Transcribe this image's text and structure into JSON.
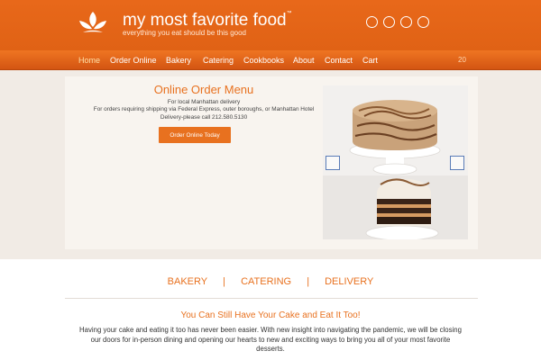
{
  "header": {
    "brand_title": "my most favorite food",
    "trademark": "™",
    "tagline": "everything you eat should be this good",
    "social_icons": [
      "social-icon-1",
      "social-icon-2",
      "social-icon-3",
      "social-icon-4"
    ]
  },
  "nav": {
    "items": [
      {
        "label": "Home",
        "active": true
      },
      {
        "label": "Order Online",
        "active": false
      },
      {
        "label": "Bakery",
        "active": false
      },
      {
        "label": "Catering",
        "active": false
      },
      {
        "label": "Cookbooks",
        "active": false
      },
      {
        "label": "About",
        "active": false
      },
      {
        "label": "Contact",
        "active": false
      },
      {
        "label": "Cart",
        "active": false
      }
    ],
    "cart_count": "20"
  },
  "order": {
    "title": "Online Order Menu",
    "note_lines": [
      "For local Manhattan delivery",
      "For orders requiring shipping via Federal Express, outer boroughs, or Manhattan Hotel",
      "Delivery-please call 212.580.5130"
    ],
    "button_label": "Order Online Today"
  },
  "slider": {
    "image_description_icon": "cake-photo",
    "prev_icon": "slider-prev-icon",
    "next_icon": "slider-next-icon"
  },
  "links": {
    "items": [
      "BAKERY",
      "CATERING",
      "DELIVERY"
    ],
    "separator": "|"
  },
  "content": {
    "heading": "You Can Still Have Your Cake and Eat It Too!",
    "body": "Having your cake and eating it too has never been easier. With new insight into navigating the pandemic, we will be closing our doors for in-person dining and opening our hearts to new and exciting ways to bring you all of your most favorite desserts."
  },
  "colors": {
    "brand_orange": "#e8711f",
    "header_orange": "#e06215",
    "nav_active": "#ffe0a8",
    "band": "#f1ebe5"
  }
}
